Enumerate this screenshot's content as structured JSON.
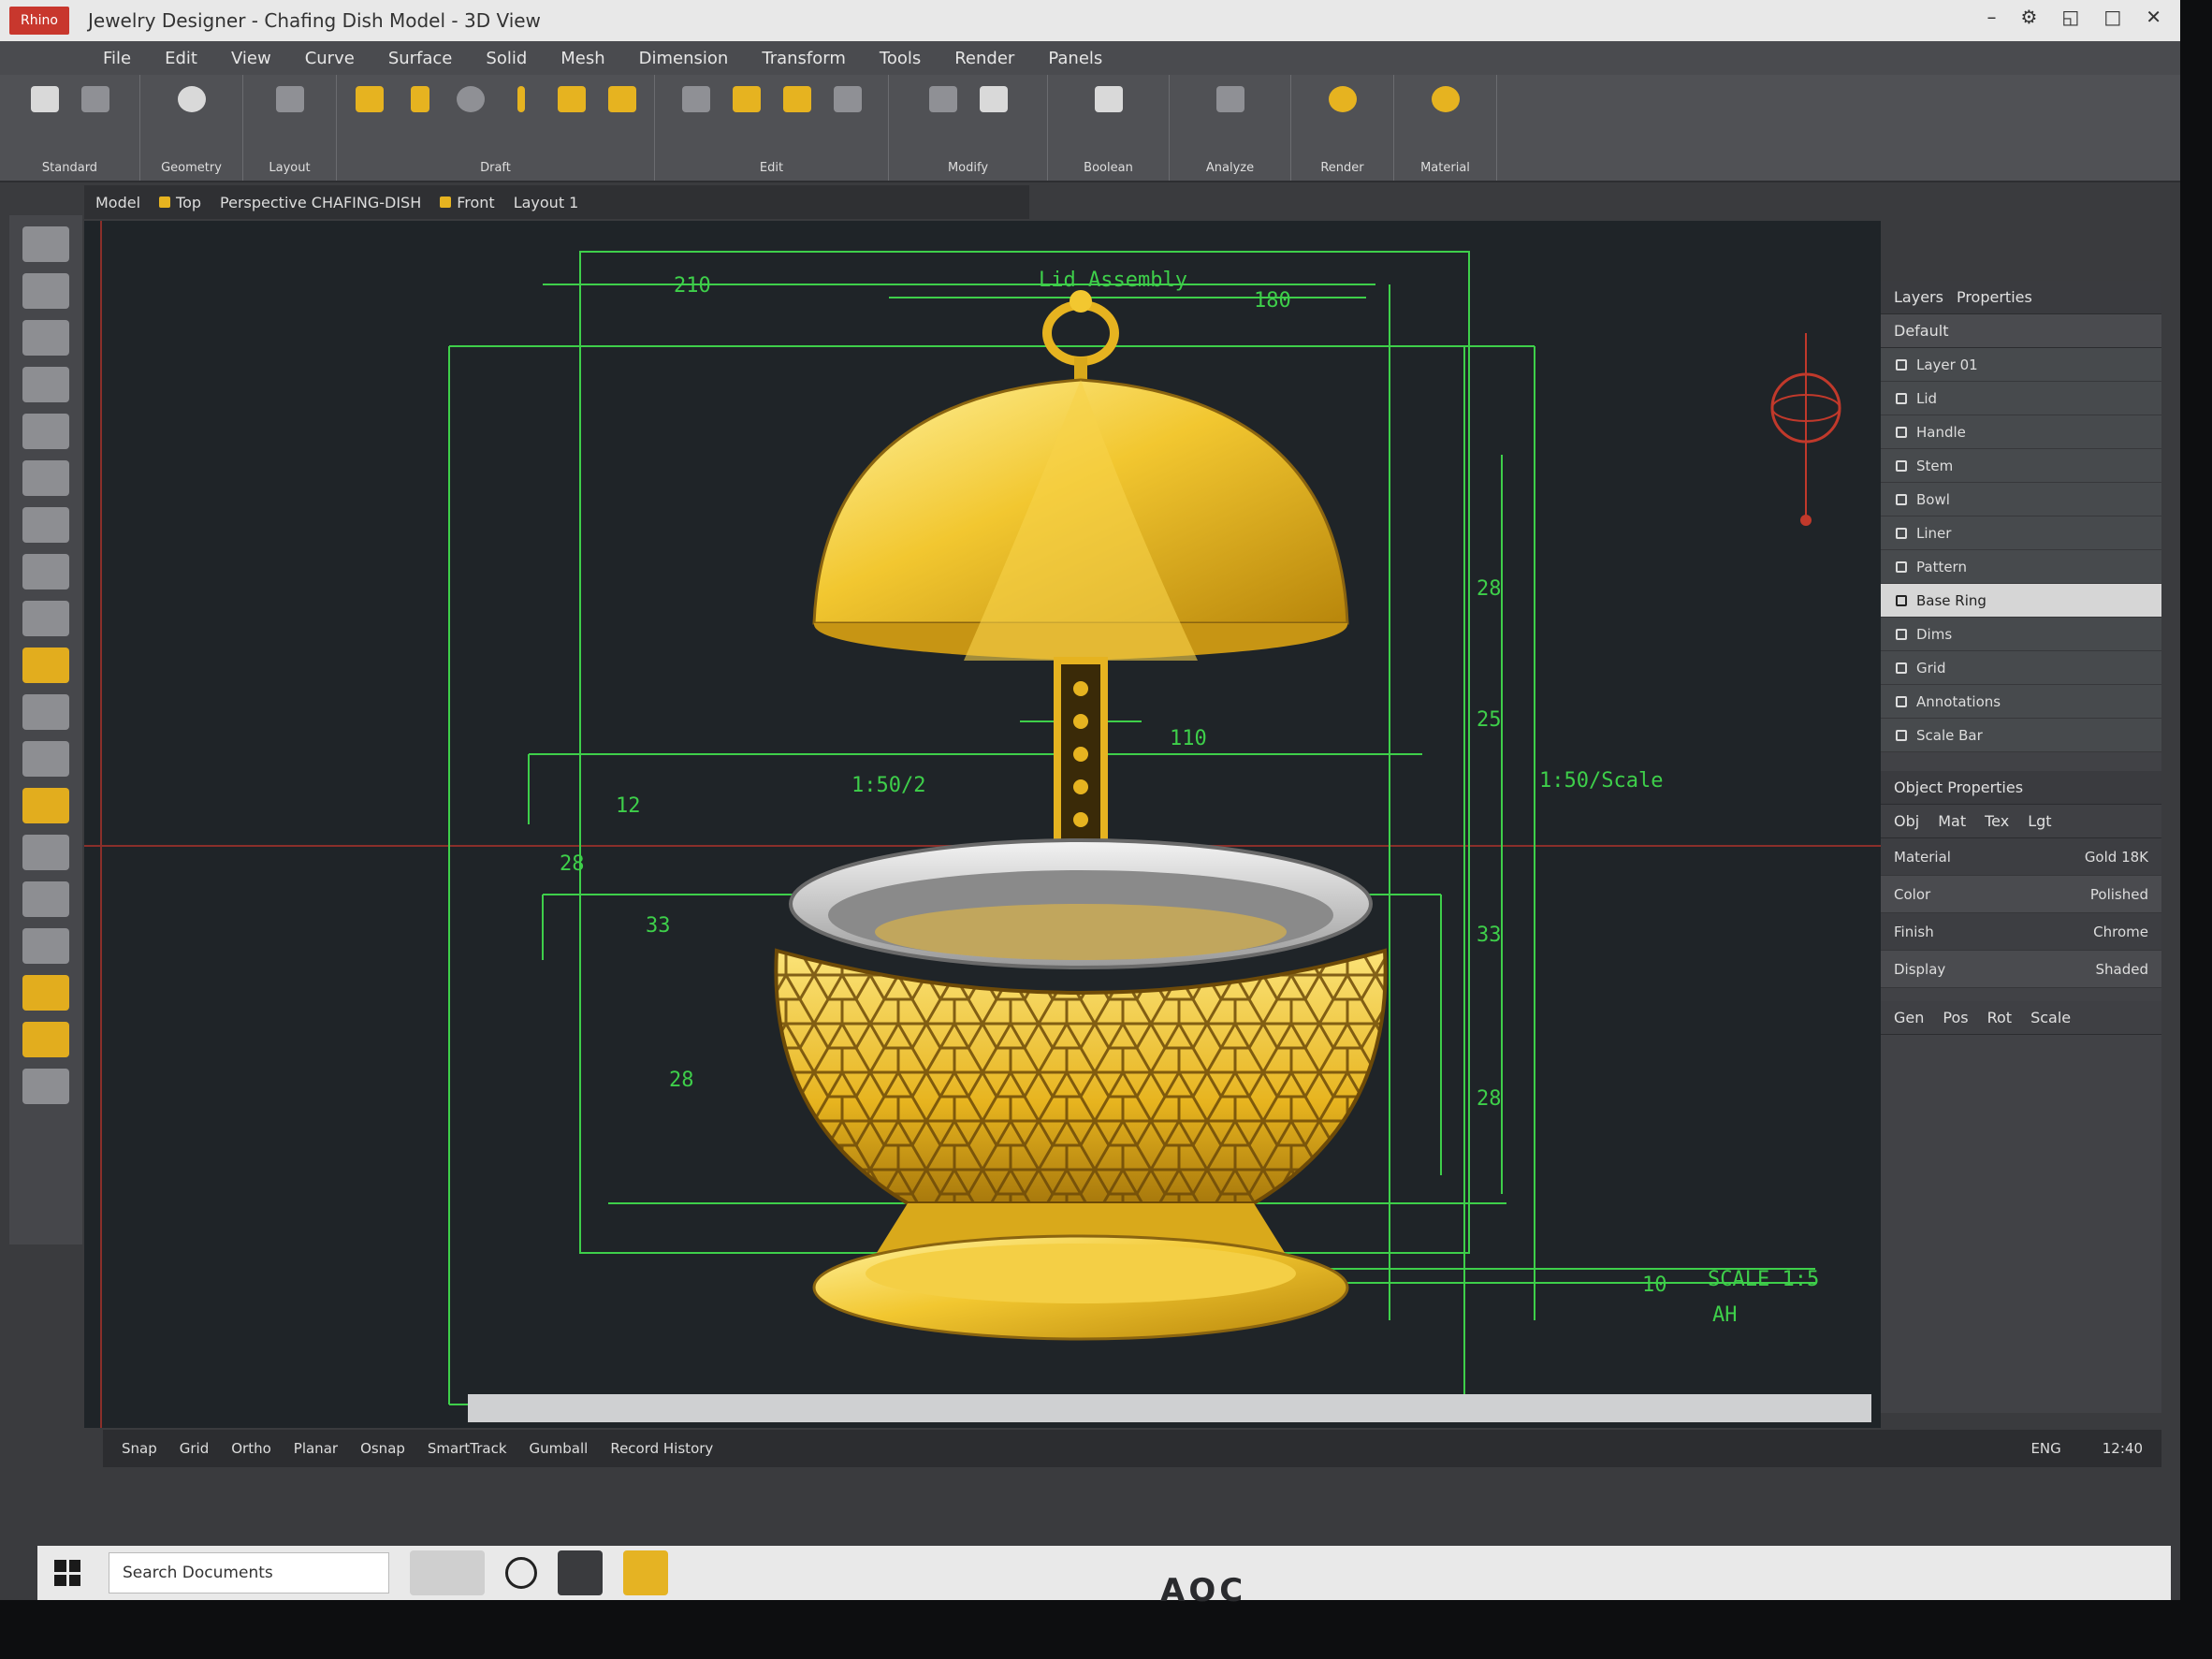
{
  "window": {
    "app_badge": "Rhino",
    "title": "Jewelry Designer - Chafing Dish Model - 3D View",
    "controls": [
      "–",
      "⚙",
      "◱",
      "□",
      "✕"
    ]
  },
  "menu": [
    "File",
    "Edit",
    "View",
    "Curve",
    "Surface",
    "Solid",
    "Mesh",
    "Dimension",
    "Transform",
    "Tools",
    "Render",
    "Panels"
  ],
  "ribbon_groups": [
    {
      "label": "Standard",
      "buttons": 2
    },
    {
      "label": "Geometry",
      "buttons": 1
    },
    {
      "label": "Layout",
      "buttons": 1
    },
    {
      "label": "Draft",
      "buttons": 6
    },
    {
      "label": "Edit",
      "buttons": 6
    },
    {
      "label": "Modify",
      "buttons": 5
    },
    {
      "label": "Boolean",
      "buttons": 2
    },
    {
      "label": "Analyze",
      "buttons": 2
    },
    {
      "label": "Render",
      "buttons": 2
    },
    {
      "label": "Material",
      "buttons": 2
    }
  ],
  "file_tabs": [
    "Model",
    "Top",
    "Perspective CHAFING-DISH",
    "Front",
    "Layout 1"
  ],
  "drawing": {
    "dimensions": {
      "top_left": "210",
      "top_center": "Lid Assembly",
      "top_right": "180",
      "stem_width": "110",
      "left_height_small": "12",
      "left_total": "28",
      "left_bowl": "33",
      "left_bowl_height": "28",
      "right_lid_height": "28",
      "right_bowl": "33",
      "right_base": "28",
      "right_height_b": "25",
      "label_left": "1:50/2",
      "label_right": "1:50/Scale",
      "scale_bar_left": "10",
      "scale_bar_text": "SCALE 1:5",
      "scale_bar_under": "AH"
    },
    "colors": {
      "dimension": "#3ecf4a",
      "crosshair": "#c0392b",
      "gold": "#e6b320",
      "background": "#1f2428"
    }
  },
  "layers_panel": {
    "head_tabs": [
      "Layers",
      "Properties"
    ],
    "search_label": "Default",
    "layers": [
      {
        "name": "Layer 01",
        "selected": false
      },
      {
        "name": "Lid",
        "selected": false
      },
      {
        "name": "Handle",
        "selected": false
      },
      {
        "name": "Stem",
        "selected": false
      },
      {
        "name": "Bowl",
        "selected": false
      },
      {
        "name": "Liner",
        "selected": false
      },
      {
        "name": "Pattern",
        "selected": false
      },
      {
        "name": "Base Ring",
        "selected": true
      },
      {
        "name": "Dims",
        "selected": false
      },
      {
        "name": "Grid",
        "selected": false
      },
      {
        "name": "Annotations",
        "selected": false
      },
      {
        "name": "Scale Bar",
        "selected": false
      }
    ]
  },
  "properties_panel": {
    "title": "Object Properties",
    "tabs": [
      "Obj",
      "Mat",
      "Tex",
      "Lgt"
    ],
    "rows": [
      "Material",
      "Color",
      "Finish",
      "Display"
    ],
    "sub_tabs": [
      "Gen",
      "Pos",
      "Rot",
      "Scale"
    ],
    "values": [
      "Gold 18K",
      "Polished",
      "Chrome",
      "Shaded"
    ]
  },
  "status": {
    "items": [
      "Snap",
      "Grid",
      "Ortho",
      "Planar",
      "Osnap",
      "SmartTrack",
      "Gumball",
      "Record History"
    ],
    "right": [
      "ENG",
      "12:40"
    ]
  },
  "taskbar": {
    "search_placeholder": "Search Documents"
  },
  "bezel_brand": "AOC"
}
